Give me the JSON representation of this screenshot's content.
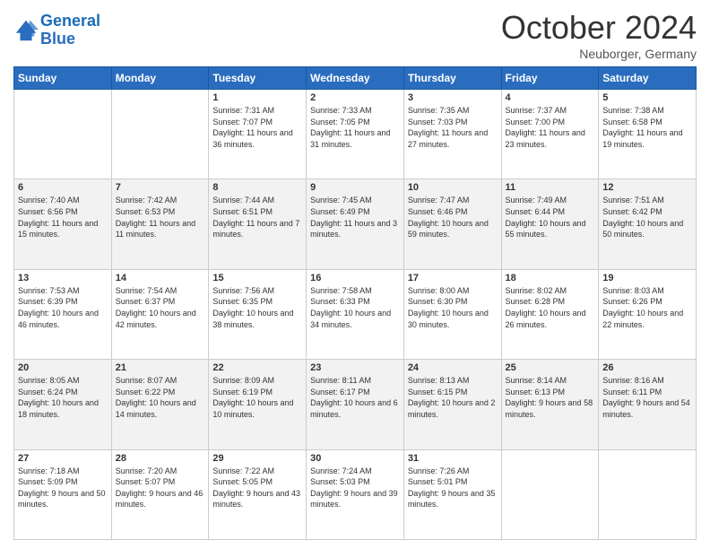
{
  "header": {
    "logo_line1": "General",
    "logo_line2": "Blue",
    "month": "October 2024",
    "location": "Neuborger, Germany"
  },
  "weekdays": [
    "Sunday",
    "Monday",
    "Tuesday",
    "Wednesday",
    "Thursday",
    "Friday",
    "Saturday"
  ],
  "rows": [
    [
      {
        "day": "",
        "info": ""
      },
      {
        "day": "",
        "info": ""
      },
      {
        "day": "1",
        "info": "Sunrise: 7:31 AM\nSunset: 7:07 PM\nDaylight: 11 hours and 36 minutes."
      },
      {
        "day": "2",
        "info": "Sunrise: 7:33 AM\nSunset: 7:05 PM\nDaylight: 11 hours and 31 minutes."
      },
      {
        "day": "3",
        "info": "Sunrise: 7:35 AM\nSunset: 7:03 PM\nDaylight: 11 hours and 27 minutes."
      },
      {
        "day": "4",
        "info": "Sunrise: 7:37 AM\nSunset: 7:00 PM\nDaylight: 11 hours and 23 minutes."
      },
      {
        "day": "5",
        "info": "Sunrise: 7:38 AM\nSunset: 6:58 PM\nDaylight: 11 hours and 19 minutes."
      }
    ],
    [
      {
        "day": "6",
        "info": "Sunrise: 7:40 AM\nSunset: 6:56 PM\nDaylight: 11 hours and 15 minutes."
      },
      {
        "day": "7",
        "info": "Sunrise: 7:42 AM\nSunset: 6:53 PM\nDaylight: 11 hours and 11 minutes."
      },
      {
        "day": "8",
        "info": "Sunrise: 7:44 AM\nSunset: 6:51 PM\nDaylight: 11 hours and 7 minutes."
      },
      {
        "day": "9",
        "info": "Sunrise: 7:45 AM\nSunset: 6:49 PM\nDaylight: 11 hours and 3 minutes."
      },
      {
        "day": "10",
        "info": "Sunrise: 7:47 AM\nSunset: 6:46 PM\nDaylight: 10 hours and 59 minutes."
      },
      {
        "day": "11",
        "info": "Sunrise: 7:49 AM\nSunset: 6:44 PM\nDaylight: 10 hours and 55 minutes."
      },
      {
        "day": "12",
        "info": "Sunrise: 7:51 AM\nSunset: 6:42 PM\nDaylight: 10 hours and 50 minutes."
      }
    ],
    [
      {
        "day": "13",
        "info": "Sunrise: 7:53 AM\nSunset: 6:39 PM\nDaylight: 10 hours and 46 minutes."
      },
      {
        "day": "14",
        "info": "Sunrise: 7:54 AM\nSunset: 6:37 PM\nDaylight: 10 hours and 42 minutes."
      },
      {
        "day": "15",
        "info": "Sunrise: 7:56 AM\nSunset: 6:35 PM\nDaylight: 10 hours and 38 minutes."
      },
      {
        "day": "16",
        "info": "Sunrise: 7:58 AM\nSunset: 6:33 PM\nDaylight: 10 hours and 34 minutes."
      },
      {
        "day": "17",
        "info": "Sunrise: 8:00 AM\nSunset: 6:30 PM\nDaylight: 10 hours and 30 minutes."
      },
      {
        "day": "18",
        "info": "Sunrise: 8:02 AM\nSunset: 6:28 PM\nDaylight: 10 hours and 26 minutes."
      },
      {
        "day": "19",
        "info": "Sunrise: 8:03 AM\nSunset: 6:26 PM\nDaylight: 10 hours and 22 minutes."
      }
    ],
    [
      {
        "day": "20",
        "info": "Sunrise: 8:05 AM\nSunset: 6:24 PM\nDaylight: 10 hours and 18 minutes."
      },
      {
        "day": "21",
        "info": "Sunrise: 8:07 AM\nSunset: 6:22 PM\nDaylight: 10 hours and 14 minutes."
      },
      {
        "day": "22",
        "info": "Sunrise: 8:09 AM\nSunset: 6:19 PM\nDaylight: 10 hours and 10 minutes."
      },
      {
        "day": "23",
        "info": "Sunrise: 8:11 AM\nSunset: 6:17 PM\nDaylight: 10 hours and 6 minutes."
      },
      {
        "day": "24",
        "info": "Sunrise: 8:13 AM\nSunset: 6:15 PM\nDaylight: 10 hours and 2 minutes."
      },
      {
        "day": "25",
        "info": "Sunrise: 8:14 AM\nSunset: 6:13 PM\nDaylight: 9 hours and 58 minutes."
      },
      {
        "day": "26",
        "info": "Sunrise: 8:16 AM\nSunset: 6:11 PM\nDaylight: 9 hours and 54 minutes."
      }
    ],
    [
      {
        "day": "27",
        "info": "Sunrise: 7:18 AM\nSunset: 5:09 PM\nDaylight: 9 hours and 50 minutes."
      },
      {
        "day": "28",
        "info": "Sunrise: 7:20 AM\nSunset: 5:07 PM\nDaylight: 9 hours and 46 minutes."
      },
      {
        "day": "29",
        "info": "Sunrise: 7:22 AM\nSunset: 5:05 PM\nDaylight: 9 hours and 43 minutes."
      },
      {
        "day": "30",
        "info": "Sunrise: 7:24 AM\nSunset: 5:03 PM\nDaylight: 9 hours and 39 minutes."
      },
      {
        "day": "31",
        "info": "Sunrise: 7:26 AM\nSunset: 5:01 PM\nDaylight: 9 hours and 35 minutes."
      },
      {
        "day": "",
        "info": ""
      },
      {
        "day": "",
        "info": ""
      }
    ]
  ]
}
